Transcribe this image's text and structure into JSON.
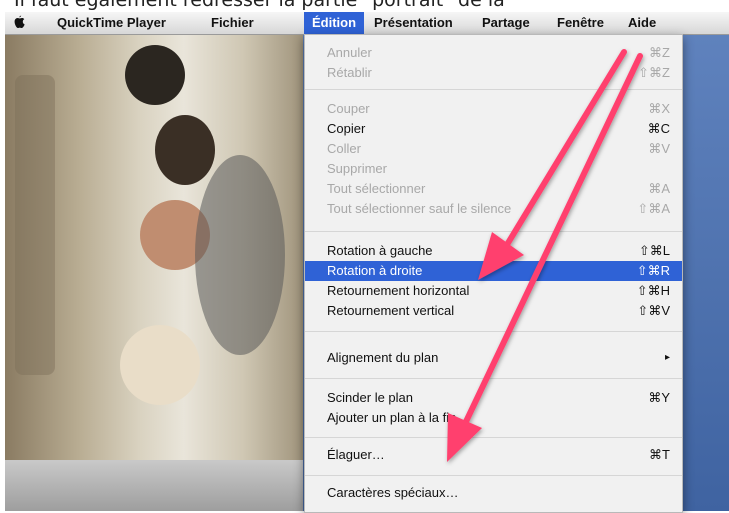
{
  "caption": "Il faut également redresser la partie \"portrait\" de la",
  "menubar": {
    "app": "QuickTime Player",
    "items": [
      "Fichier",
      "Édition",
      "Présentation",
      "Partage",
      "Fenêtre",
      "Aide"
    ],
    "active": "Édition"
  },
  "menu": {
    "items": [
      {
        "label": "Annuler",
        "shortcut": "⌘Z",
        "enabled": false
      },
      {
        "label": "Rétablir",
        "shortcut": "⇧⌘Z",
        "enabled": false
      },
      {
        "label": "Couper",
        "shortcut": "⌘X",
        "enabled": false
      },
      {
        "label": "Copier",
        "shortcut": "⌘C",
        "enabled": true
      },
      {
        "label": "Coller",
        "shortcut": "⌘V",
        "enabled": false
      },
      {
        "label": "Supprimer",
        "shortcut": "",
        "enabled": false
      },
      {
        "label": "Tout sélectionner",
        "shortcut": "⌘A",
        "enabled": false
      },
      {
        "label": "Tout sélectionner sauf le silence",
        "shortcut": "⇧⌘A",
        "enabled": false
      },
      {
        "label": "Rotation à gauche",
        "shortcut": "⇧⌘L",
        "enabled": true
      },
      {
        "label": "Rotation à droite",
        "shortcut": "⇧⌘R",
        "enabled": true,
        "selected": true
      },
      {
        "label": "Retournement horizontal",
        "shortcut": "⇧⌘H",
        "enabled": true
      },
      {
        "label": "Retournement vertical",
        "shortcut": "⇧⌘V",
        "enabled": true
      },
      {
        "label": "Alignement du plan",
        "shortcut": "▸",
        "enabled": true
      },
      {
        "label": "Scinder le plan",
        "shortcut": "⌘Y",
        "enabled": true
      },
      {
        "label": "Ajouter un plan à la fin…",
        "shortcut": "",
        "enabled": true
      },
      {
        "label": "Élaguer…",
        "shortcut": "⌘T",
        "enabled": true
      },
      {
        "label": "Caractères spéciaux…",
        "shortcut": "",
        "enabled": true
      }
    ]
  },
  "colors": {
    "highlight": "#2f62d6",
    "arrow": "#ff3f6e"
  }
}
